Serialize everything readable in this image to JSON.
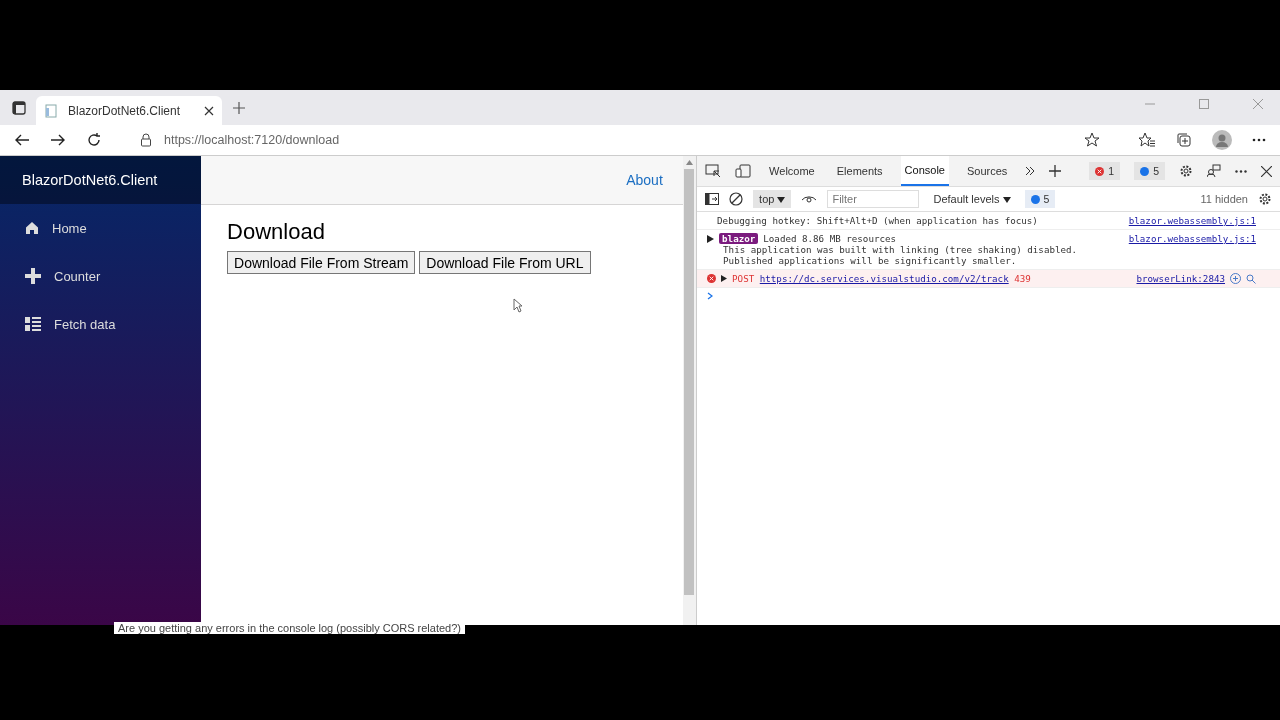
{
  "browser": {
    "tabs": [
      {
        "title": "BlazorDotNet6.Client",
        "selected": true
      }
    ],
    "address": "https://localhost:7120/download"
  },
  "app": {
    "brand": "BlazorDotNet6.Client",
    "nav": [
      {
        "label": "Home",
        "kind": "home",
        "selected": false
      },
      {
        "label": "Counter",
        "kind": "plus",
        "selected": false
      },
      {
        "label": "Fetch data",
        "kind": "list",
        "selected": false
      }
    ],
    "top_link": "About",
    "heading": "Download",
    "buttons": [
      "Download File From Stream",
      "Download File From URL"
    ]
  },
  "devtools": {
    "tabs": [
      {
        "label": "Welcome",
        "selected": false
      },
      {
        "label": "Elements",
        "selected": false
      },
      {
        "label": "Console",
        "selected": true
      },
      {
        "label": "Sources",
        "selected": false
      }
    ],
    "errors": "1",
    "messages": "5",
    "context": "top",
    "filter_placeholder": "Filter",
    "levels": "Default levels",
    "message_count": "5",
    "hidden": "11 hidden",
    "console": [
      {
        "kind": "log",
        "text": "Debugging hotkey: Shift+Alt+D (when application has focus)",
        "source": "blazor.webassembly.js:1"
      },
      {
        "kind": "group",
        "badge": "blazor",
        "text": "Loaded 8.86 MB resources",
        "detail": "This application was built with linking (tree shaking) disabled. Published applications will be significantly smaller.",
        "source": "blazor.webassembly.js:1"
      },
      {
        "kind": "error",
        "method": "POST",
        "url": "https://dc.services.visualstudio.com/v2/track",
        "code": "439",
        "source": "browserLink:2843"
      }
    ]
  },
  "underlay_text": "Are you getting any errors in the console log (possibly CORS related?)"
}
